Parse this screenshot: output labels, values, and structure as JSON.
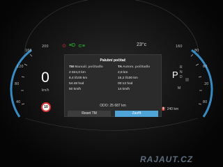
{
  "status_bar": {
    "temperature": "23°c"
  },
  "left_gauge": {
    "speed": "0",
    "unit": "km/h",
    "speed_limit": "10",
    "ticks": [
      "200",
      "160",
      "120",
      "80",
      "40"
    ]
  },
  "right_gauge": {
    "ticks": [
      "160",
      "80",
      "60",
      "20",
      "80"
    ],
    "gear": "P",
    "gear_list": [
      "R",
      "N",
      "D"
    ],
    "drive_mode": "M"
  },
  "panel": {
    "title": "Palubní počítač",
    "left": {
      "header": "TM",
      "subheader": "Manuál. počítadlo",
      "lines": [
        "2 824,0 km",
        "8,4 l/100 km",
        "54:48 hod",
        "50 km/h"
      ]
    },
    "right": {
      "header": "TA",
      "subheader": "Autom. počítadlo",
      "lines": [
        "2,8 km",
        "15,2 l/100 km",
        "00:12 hod",
        "14 km/h"
      ]
    },
    "odometer": "ODO: 25 687 km",
    "reset_label": "Reset TM",
    "close_label": "Zavřít"
  },
  "range": "240 km",
  "watermark": "RAJAUT.CZ"
}
